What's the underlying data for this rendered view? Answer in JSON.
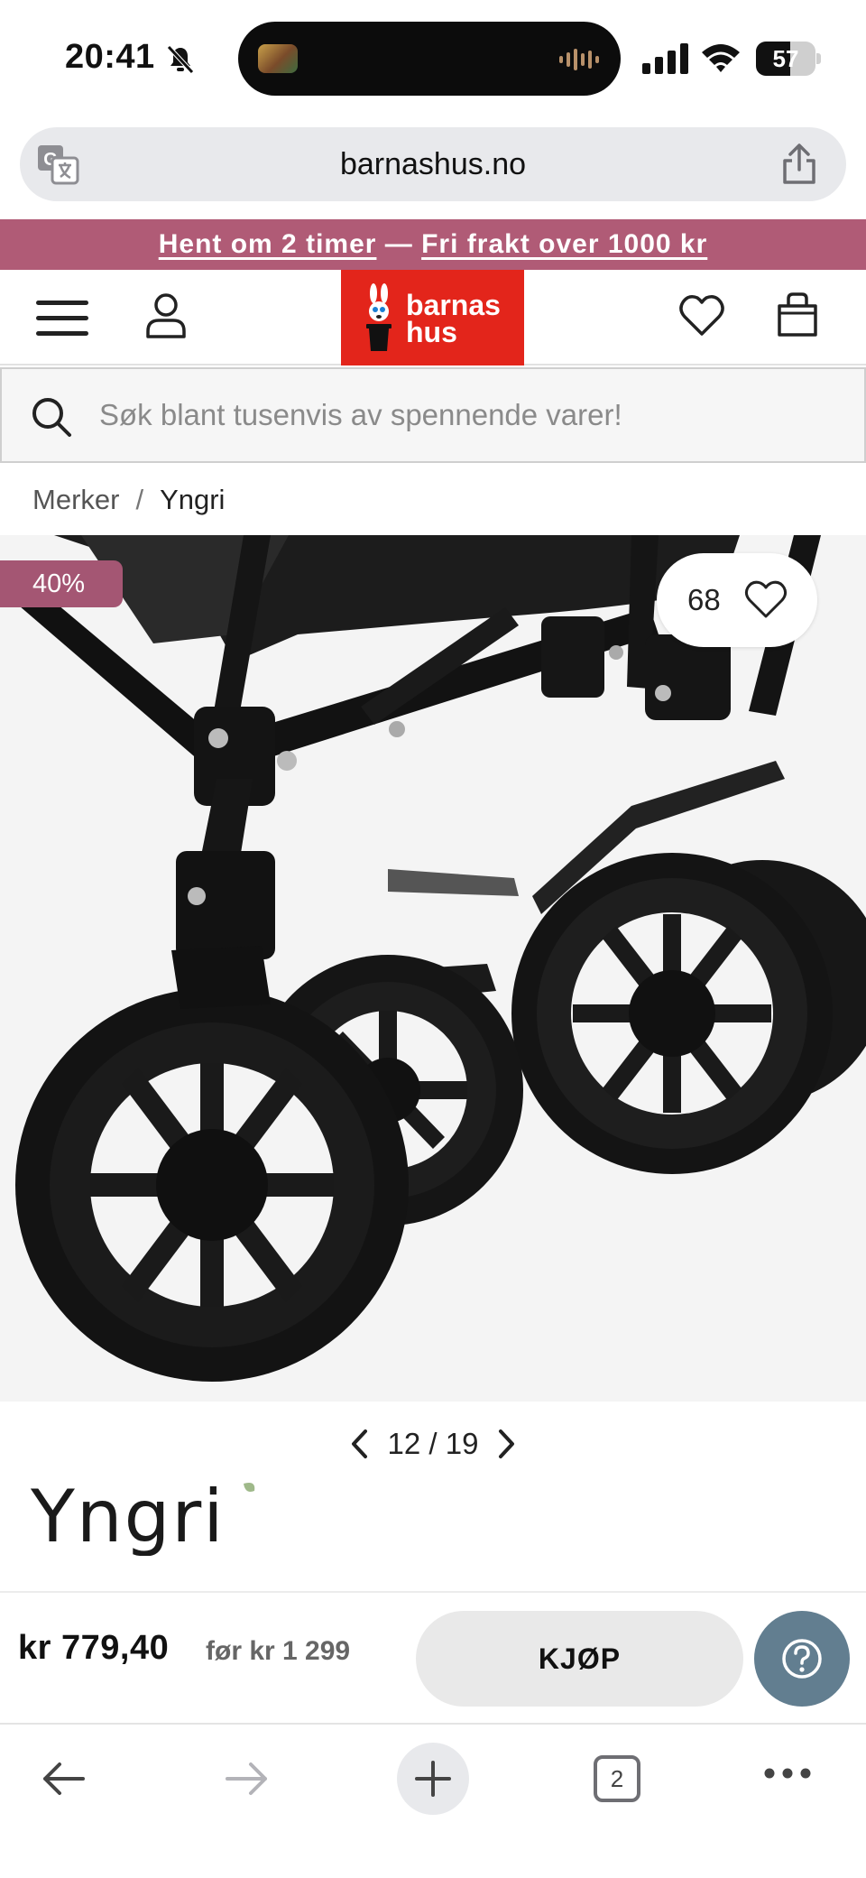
{
  "status_bar": {
    "time": "20:41",
    "battery_level": "57",
    "battery_percent": 57
  },
  "browser": {
    "url": "barnashus.no"
  },
  "promo": {
    "pickup_link": "Hent om 2 timer",
    "separator": " — ",
    "shipping_link": "Fri frakt over 1000 kr"
  },
  "header": {
    "logo_line1": "barnas",
    "logo_line2": "hus"
  },
  "search": {
    "placeholder": "Søk blant tusenvis av spennende varer!"
  },
  "breadcrumb": {
    "parent": "Merker",
    "separator": "/",
    "current": "Yngri"
  },
  "product": {
    "discount_badge": "40%",
    "favorite_count": "68",
    "image_index": "12 / 19",
    "brand_logo_text": "Yngri",
    "price": "kr 779,40",
    "old_price": "før kr 1 299",
    "buy_label": "KJØP"
  },
  "toolbar": {
    "tab_count": "2"
  },
  "colors": {
    "promo_bg": "#b05b76",
    "logo_red": "#e3251b",
    "badge_bg": "#a45673",
    "help_button": "#627e90"
  },
  "icons": [
    "bell-slash-icon",
    "signal-icon",
    "wifi-icon",
    "translate-icon",
    "share-icon",
    "hamburger-menu-icon",
    "account-icon",
    "heart-icon",
    "shopping-bag-icon",
    "search-icon",
    "chevron-left-icon",
    "chevron-right-icon",
    "question-icon",
    "back-arrow-icon",
    "forward-arrow-icon",
    "plus-icon",
    "more-icon"
  ]
}
